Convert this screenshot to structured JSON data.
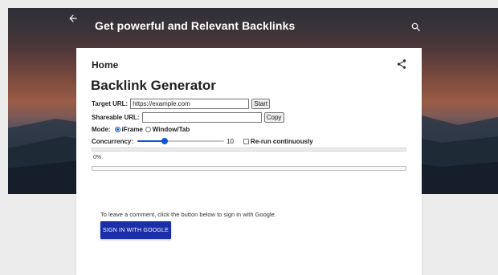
{
  "header": {
    "blog_title": "Get powerful and Relevant Backlinks",
    "back_icon": "arrow-left-icon",
    "search_icon": "search-icon"
  },
  "card": {
    "breadcrumb": "Home",
    "share_icon": "share-icon",
    "title": "Backlink Generator"
  },
  "form": {
    "target_url_label": "Target URL:",
    "target_url_value": "https://example.com",
    "start_label": "Start",
    "shareable_url_label": "Shareable URL:",
    "shareable_url_value": "",
    "copy_label": "Copy",
    "mode_label": "Mode:",
    "mode_options": [
      "iFrame",
      "Window/Tab"
    ],
    "mode_selected": "iFrame",
    "concurrency_label": "Concurrency:",
    "concurrency_value": "10",
    "concurrency_fraction": 0.3,
    "rerun_label": "Re-run continuously",
    "rerun_checked": false,
    "progress_percent": 0,
    "progress_text": "0%"
  },
  "comments": {
    "prompt": "To leave a comment, click the button below to sign in with Google.",
    "signin_label": "SIGN IN WITH GOOGLE"
  },
  "colors": {
    "accent": "#0b57d0",
    "signin_button": "#1a2fa8"
  }
}
